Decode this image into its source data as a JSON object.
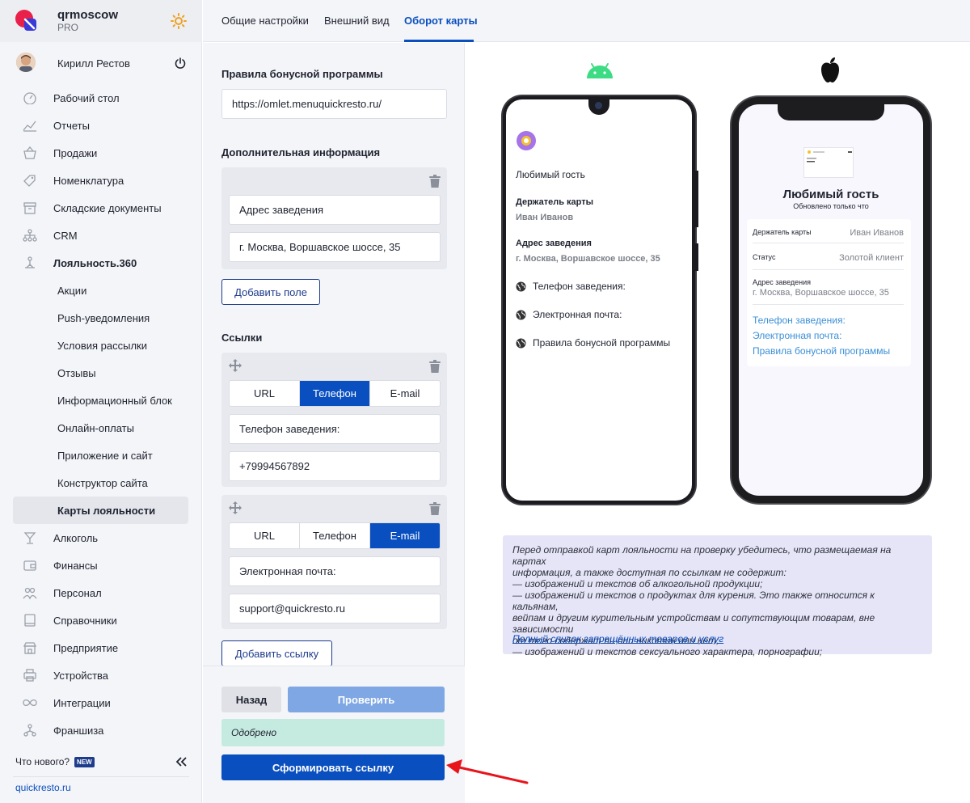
{
  "brand": {
    "name": "qrmoscow",
    "plan": "PRO"
  },
  "user": {
    "name": "Кирилл Рестов"
  },
  "sidebar": {
    "items": [
      {
        "label": "Рабочий стол",
        "icon": "dashboard-icon"
      },
      {
        "label": "Отчеты",
        "icon": "chart-icon"
      },
      {
        "label": "Продажи",
        "icon": "basket-icon"
      },
      {
        "label": "Номенклатура",
        "icon": "tag-icon"
      },
      {
        "label": "Складские документы",
        "icon": "archive-icon"
      },
      {
        "label": "CRM",
        "icon": "hierarchy-icon"
      },
      {
        "label": "Лояльность.360",
        "icon": "loyalty-icon"
      }
    ],
    "sub_items": [
      "Акции",
      "Push-уведомления",
      "Условия рассылки",
      "Отзывы",
      "Информационный блок",
      "Онлайн-оплаты",
      "Приложение и сайт",
      "Конструктор сайта",
      "Карты лояльности"
    ],
    "items_bottom": [
      {
        "label": "Алкоголь",
        "icon": "glass-icon"
      },
      {
        "label": "Финансы",
        "icon": "wallet-icon"
      },
      {
        "label": "Персонал",
        "icon": "people-icon"
      },
      {
        "label": "Справочники",
        "icon": "book-icon"
      },
      {
        "label": "Предприятие",
        "icon": "store-icon"
      },
      {
        "label": "Устройства",
        "icon": "printer-icon"
      },
      {
        "label": "Интеграции",
        "icon": "infinity-icon"
      },
      {
        "label": "Франшиза",
        "icon": "franchise-icon"
      }
    ],
    "whats_new": "Что нового?",
    "new_badge": "NEW",
    "site_link": "quickresto.ru"
  },
  "tabs": [
    "Общие настройки",
    "Внешний вид",
    "Оборот карты"
  ],
  "form": {
    "bonus_rules_title": "Правила бонусной программы",
    "bonus_rules_url": "https://omlet.menuquickresto.ru/",
    "extra_info_title": "Дополнительная информация",
    "extra_fields": [
      "Адрес заведения",
      "г. Москва, Воршавское шоссе, 35"
    ],
    "add_field": "Добавить поле",
    "links_title": "Ссылки",
    "link_types": [
      "URL",
      "Телефон",
      "E-mail"
    ],
    "links": [
      {
        "selected": "Телефон",
        "label": "Телефон заведения:",
        "value": "+79994567892"
      },
      {
        "selected": "E-mail",
        "label": "Электронная почта:",
        "value": "support@quickresto.ru"
      }
    ],
    "add_link": "Добавить ссылку",
    "back": "Назад",
    "check": "Проверить",
    "status": "Одобрено",
    "generate": "Сформировать ссылку"
  },
  "android_card": {
    "title": "Любимый гость",
    "holder_label": "Держатель карты",
    "holder_value": "Иван Иванов",
    "address_label": "Адрес заведения",
    "address_value": "г. Москва, Воршавское шоссе, 35",
    "links": [
      "Телефон заведения:",
      "Электронная почта:",
      "Правила бонусной программы"
    ]
  },
  "ios_card": {
    "title": "Любимый гость",
    "subtitle": "Обновлено только что",
    "rows": [
      {
        "label": "Держатель карты",
        "value": "Иван Иванов"
      },
      {
        "label": "Статус",
        "value": "Золотой клиент"
      }
    ],
    "address_label": "Адрес заведения",
    "address_value": "г. Москва, Воршавское шоссе, 35",
    "links": [
      "Телефон заведения:",
      "Электронная почта:",
      "Правила бонусной программы"
    ]
  },
  "notice": {
    "lines": [
      "Перед отправкой карт лояльности на проверку убедитесь, что размещаемая на картах",
      "информация, а также доступная по ссылкам не содержит:",
      "— изображений и текстов об алкогольной продукции;",
      "— изображений и текстов о продуктах для курения. Это также относится к кальянам,",
      "вейпам и другим курительным устройствам и сопутствующим товарам, вне зависимости",
      "от того содержат ли они никотин или нет;",
      "— изображений и текстов сексуального характера, порнографии;"
    ],
    "link": "Полный список запрещённых товаров и услуг"
  },
  "colors": {
    "accent": "#0a4fbf",
    "approved_bg": "#c5ebe0",
    "notice_bg": "#e6e5f8",
    "arrow": "#e8141c"
  }
}
